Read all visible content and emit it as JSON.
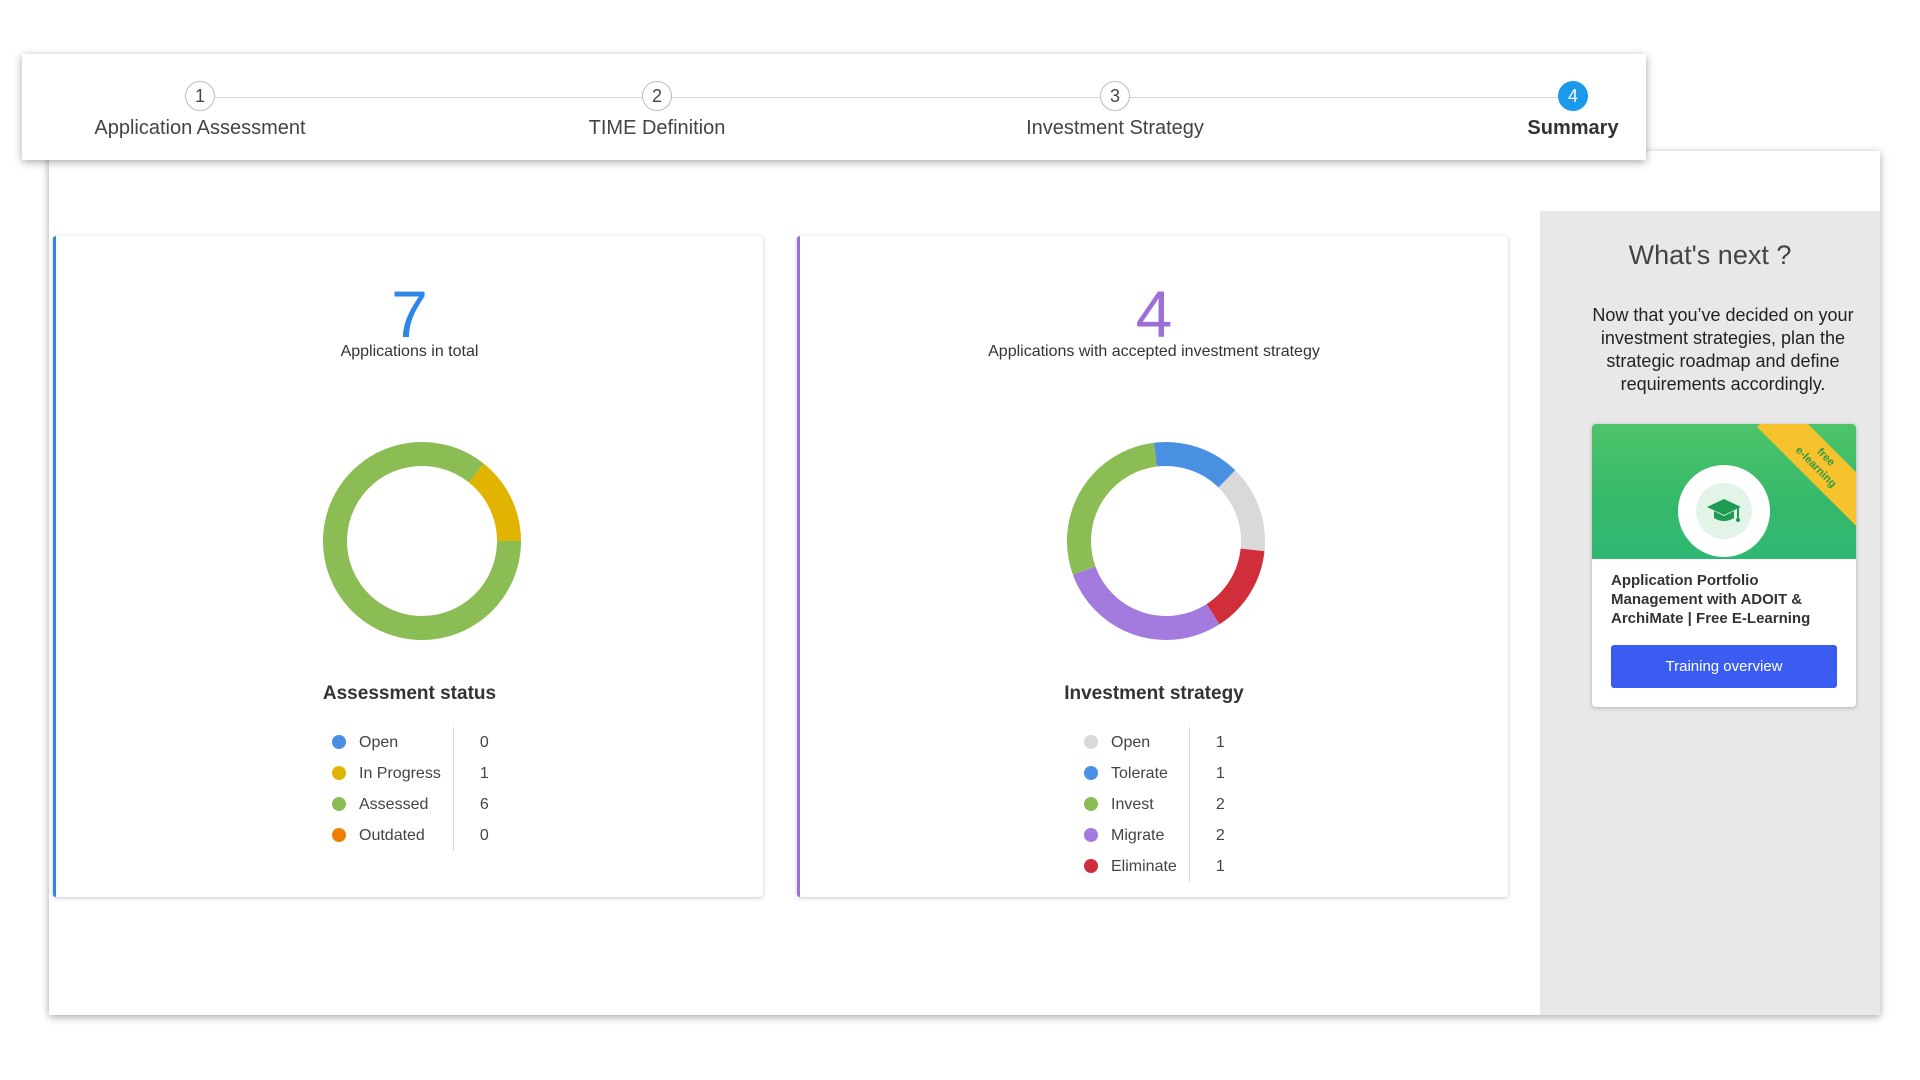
{
  "stepper": {
    "steps": [
      {
        "number": "1",
        "label": "Application Assessment",
        "active": false
      },
      {
        "number": "2",
        "label": "TIME Definition",
        "active": false
      },
      {
        "number": "3",
        "label": "Investment Strategy",
        "active": false
      },
      {
        "number": "4",
        "label": "Summary",
        "active": true
      }
    ]
  },
  "assessment": {
    "total": "7",
    "total_label": "Applications in total",
    "number_color": "#2e86e6",
    "title": "Assessment status",
    "items": [
      {
        "label": "Open",
        "value": "0",
        "color": "#4a90e2"
      },
      {
        "label": "In Progress",
        "value": "1",
        "color": "#e0b400"
      },
      {
        "label": "Assessed",
        "value": "6",
        "color": "#8bbd54"
      },
      {
        "label": "Outdated",
        "value": "0",
        "color": "#ee7f00"
      }
    ]
  },
  "investment": {
    "total": "4",
    "total_label": "Applications with accepted investment strategy",
    "number_color": "#9c6fd8",
    "title": "Investment strategy",
    "items": [
      {
        "label": "Open",
        "value": "1",
        "color": "#d9d9d9"
      },
      {
        "label": "Tolerate",
        "value": "1",
        "color": "#4a90e2"
      },
      {
        "label": "Invest",
        "value": "2",
        "color": "#8bbd54"
      },
      {
        "label": "Migrate",
        "value": "2",
        "color": "#a37ade"
      },
      {
        "label": "Eliminate",
        "value": "1",
        "color": "#cf2e3a"
      }
    ]
  },
  "whats_next": {
    "title": "What's next ?",
    "text": "Now that you’ve decided on your investment strategies, plan the strategic roadmap and define requirements accordingly.",
    "card": {
      "ribbon_line1": "free",
      "ribbon_line2": "e-learning",
      "title": "Application Portfolio Management with ADOIT & ArchiMate | Free E-Learning",
      "button": "Training overview",
      "icon": "graduation-cap-icon"
    }
  }
}
